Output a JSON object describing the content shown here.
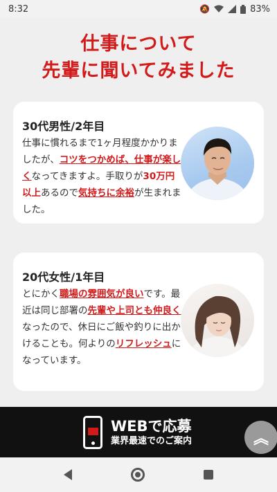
{
  "status_bar": {
    "time": "8:32",
    "battery": "83%",
    "icons": [
      "mute-icon",
      "wifi-icon",
      "signal-icon",
      "battery-icon"
    ]
  },
  "headline": {
    "line1": "仕事について",
    "line2": "先輩に聞いてみました"
  },
  "testimonials": [
    {
      "title": "30代男性/2年目",
      "segments": [
        {
          "text": "仕事に慣れるまで1ヶ月程度かかりましたが、",
          "style": "plain"
        },
        {
          "text": "コツをつかめば、仕事が楽しく",
          "style": "highlight-underline"
        },
        {
          "text": "なってきますよ。手取りが",
          "style": "plain"
        },
        {
          "text": "30万円以上",
          "style": "highlight"
        },
        {
          "text": "あるので",
          "style": "plain"
        },
        {
          "text": "気持ちに余裕",
          "style": "highlight-underline"
        },
        {
          "text": "が生まれました。",
          "style": "plain"
        }
      ],
      "avatar": "male-portrait"
    },
    {
      "title": "20代女性/1年目",
      "segments": [
        {
          "text": "とにかく",
          "style": "plain"
        },
        {
          "text": "職場の雰囲気が良い",
          "style": "highlight-underline"
        },
        {
          "text": "です。最近は同じ部署の",
          "style": "plain"
        },
        {
          "text": "先輩や上司とも仲良く",
          "style": "highlight-underline"
        },
        {
          "text": "なったので、休日にご飯や釣りに出かけることも。何よりの",
          "style": "plain"
        },
        {
          "text": "リフレッシュ",
          "style": "highlight-underline"
        },
        {
          "text": "になっています。",
          "style": "plain"
        }
      ],
      "avatar": "female-portrait"
    }
  ],
  "cta": {
    "main": "WEBで応募",
    "sub": "業界最速でのご案内",
    "icon": "phone-mail-icon"
  },
  "scroll_top": {
    "icon": "double-chevron-up-icon",
    "glyph": "︽"
  },
  "colors": {
    "accent_red": "#d21a1a",
    "background": "#efefef",
    "cta_background": "#111111"
  }
}
